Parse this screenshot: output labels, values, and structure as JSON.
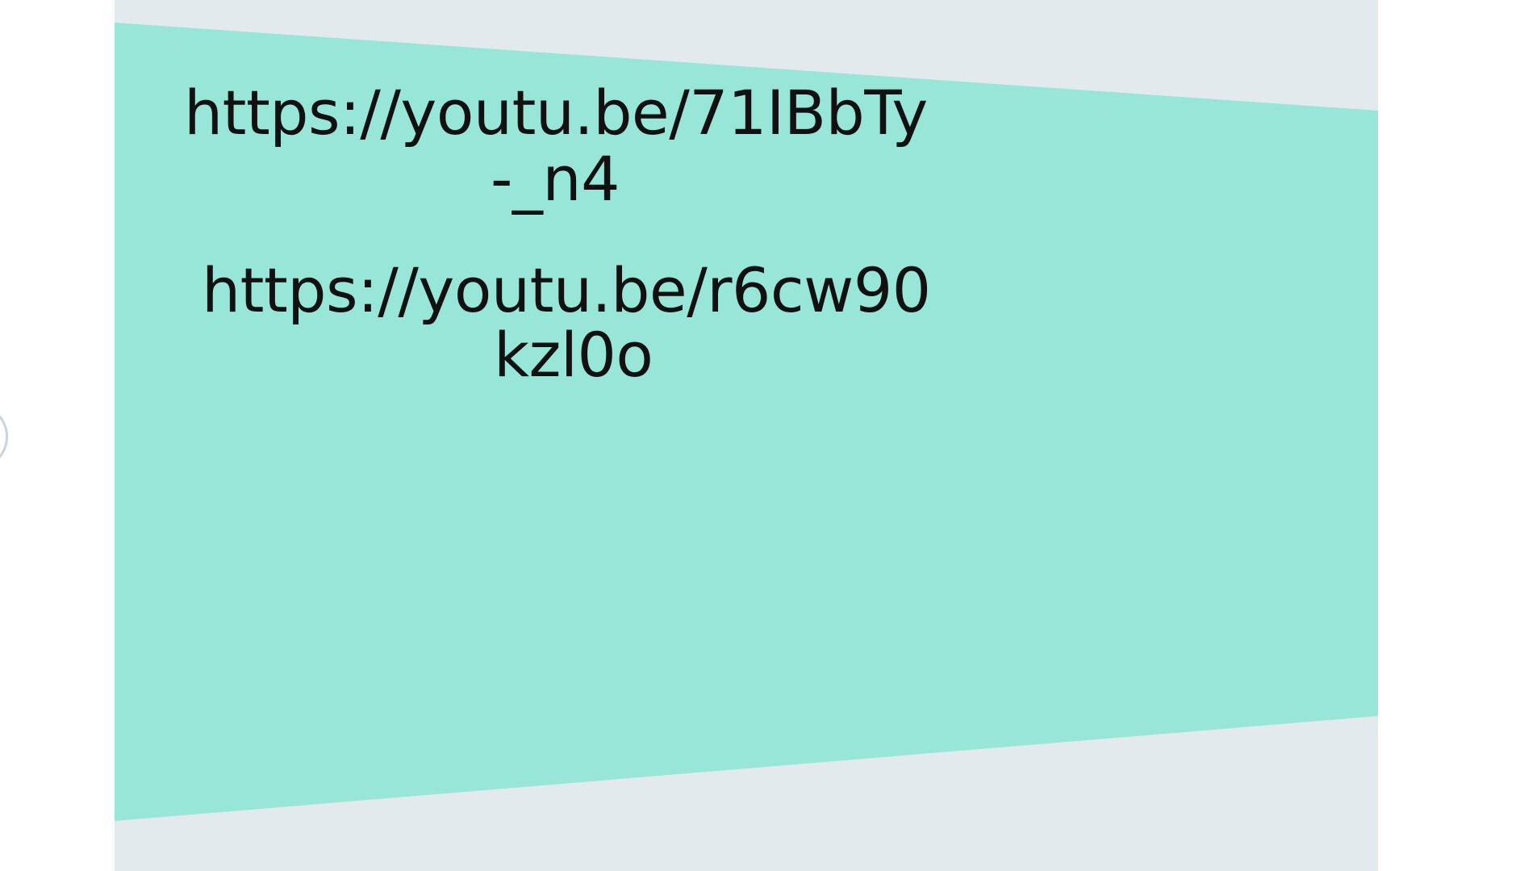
{
  "slide": {
    "links": [
      {
        "line1": "https://youtu.be/71IBbTy",
        "line2": "-_n4"
      },
      {
        "line1": "https://youtu.be/r6cw90",
        "line2": "kzl0o"
      }
    ]
  },
  "colors": {
    "page_background": "#ffffff",
    "slide_background": "#e3eaed",
    "band": "#98e6d7",
    "text": "#111111"
  }
}
